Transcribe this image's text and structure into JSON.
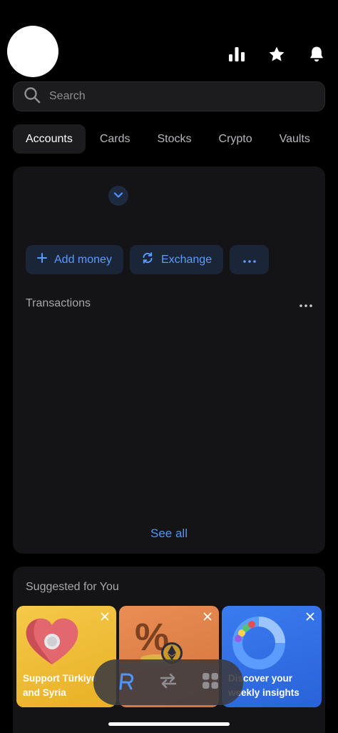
{
  "header": {
    "icons": [
      "analytics-icon",
      "star-icon",
      "bell-icon"
    ]
  },
  "search": {
    "placeholder": "Search",
    "value": ""
  },
  "tabs": [
    {
      "label": "Accounts",
      "active": true
    },
    {
      "label": "Cards",
      "active": false
    },
    {
      "label": "Stocks",
      "active": false
    },
    {
      "label": "Crypto",
      "active": false
    },
    {
      "label": "Vaults",
      "active": false
    }
  ],
  "account": {
    "actions": {
      "add_money": "Add money",
      "exchange": "Exchange"
    },
    "transactions_title": "Transactions",
    "see_all": "See all"
  },
  "suggested": {
    "title": "Suggested for You",
    "items": [
      {
        "label": "Support Türkiye and Syria",
        "color": "#f2c23a"
      },
      {
        "label": "",
        "color": "#e4864d"
      },
      {
        "label": "Discover your weekly insights",
        "color": "#2f6fe6"
      }
    ]
  },
  "bottom_nav": [
    "revolut-home-icon",
    "transfer-icon",
    "apps-grid-icon"
  ],
  "colors": {
    "background": "#000000",
    "card": "#141416",
    "accent": "#4f95ff"
  }
}
